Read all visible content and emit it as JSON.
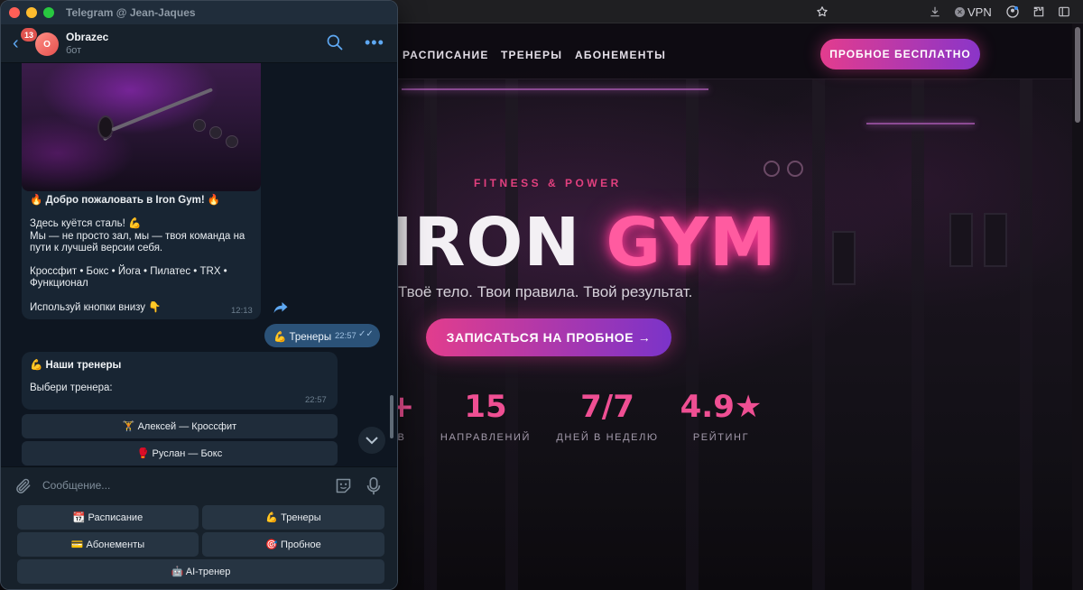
{
  "browser": {
    "vpn_label": "VPN",
    "nav": {
      "links": [
        "РАСПИСАНИЕ",
        "ТРЕНЕРЫ",
        "АБОНЕМЕНТЫ"
      ],
      "cta": "ПРОБНОЕ БЕСПЛАТНО"
    },
    "hero": {
      "eyebrow": "FITNESS & POWER",
      "title_word1": "IRON",
      "title_word2": "GYM",
      "subtitle": "Твоё тело. Твои правила. Твой результат.",
      "cta": "ЗАПИСАТЬСЯ НА ПРОБНОЕ →"
    },
    "stats": [
      {
        "number": "+",
        "label": "В"
      },
      {
        "number": "15",
        "label": "НАПРАВЛЕНИЙ"
      },
      {
        "number": "7/7",
        "label": "ДНЕЙ В НЕДЕЛЮ"
      },
      {
        "number": "4.9★",
        "label": "РЕЙТИНГ"
      }
    ],
    "colors": {
      "accent": "#e33c8e",
      "accent2": "#8a35c9"
    }
  },
  "telegram": {
    "window_title": "Telegram @ Jean-Jaques",
    "unread_count": "13",
    "avatar_initial": "O",
    "chat_name": "Obrazec",
    "chat_status": "бот",
    "messages": {
      "welcome": {
        "lines": [
          "🔥 Добро пожаловать в Iron Gym! 🔥",
          "",
          "Здесь куётся сталь! 💪",
          "Мы — не просто зал, мы — твоя команда на",
          "пути к лучшей версии себя.",
          "",
          "Кроссфит • Бокс • Йога • Пилатес • TRX •",
          "Функционал",
          "",
          "Используй кнопки внизу 👇"
        ],
        "time": "12:13"
      },
      "outgoing": {
        "text": "💪 Тренеры",
        "time": "22:57",
        "checks": "✓✓"
      },
      "trainers": {
        "title": "💪 Наши тренеры",
        "body": "Выбери тренера:",
        "time": "22:57"
      }
    },
    "inline_buttons": [
      "🏋️ Алексей — Кроссфит",
      "🥊 Руслан — Бокс"
    ],
    "composer_placeholder": "Сообщение...",
    "keyboard": {
      "schedule": "📆 Расписание",
      "trainers": "💪 Тренеры",
      "subscriptions": "💳 Абонементы",
      "trial": "🎯 Пробное",
      "ai_trainer": "🤖 AI-тренер"
    },
    "colors": {
      "outgoing_bubble": "#2b5278",
      "incoming_bubble": "#182533",
      "link": "#5ea8f2"
    }
  }
}
